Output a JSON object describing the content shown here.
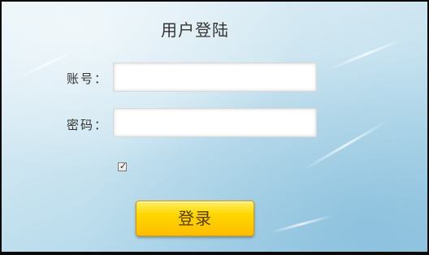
{
  "form": {
    "title": "用户登陆",
    "account_label": "账号：",
    "account_value": "",
    "password_label": "密码：",
    "password_value": "",
    "remember_checked": true,
    "login_button_label": "登录"
  },
  "colors": {
    "background_top": "#e6f2f8",
    "background_bottom": "#9fcde4",
    "button_top": "#fff06a",
    "button_bottom": "#ffbd00",
    "border": "#0a0a0a"
  }
}
